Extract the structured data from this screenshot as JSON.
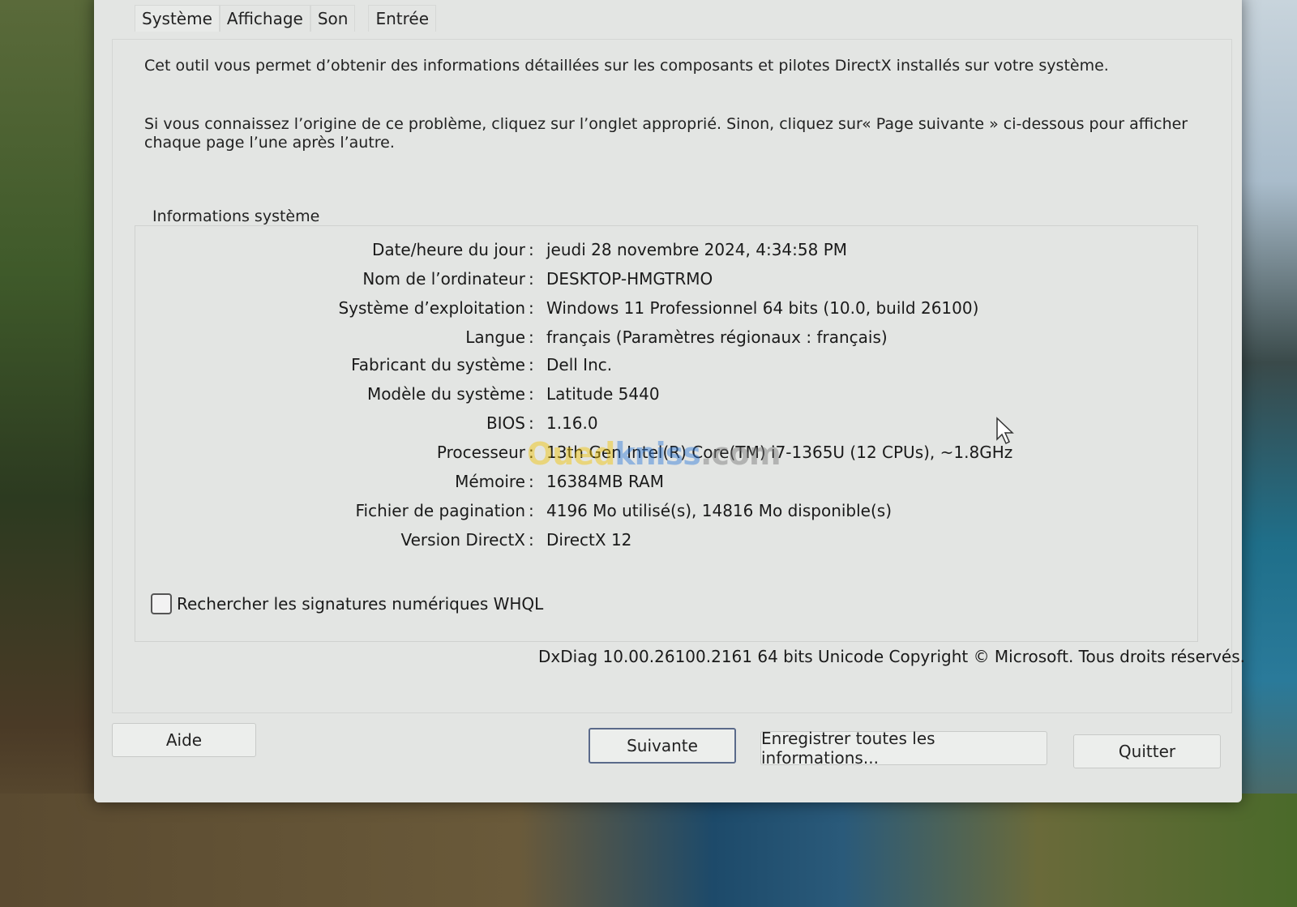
{
  "tabs": [
    "Système",
    "Affichage",
    "Son",
    "Entrée"
  ],
  "intro_1": "Cet outil vous permet d’obtenir des informations détaillées sur les composants et pilotes DirectX installés sur votre système.",
  "intro_2": "Si vous connaissez l’origine de ce problème, cliquez sur l’onglet approprié. Sinon, cliquez sur« Page suivante » ci-dessous pour afficher chaque page l’une après l’autre.",
  "group_title": "Informations système",
  "separator": ":",
  "rows": [
    {
      "label": "Date/heure du jour",
      "value": "jeudi 28 novembre 2024, 4:34:58 PM"
    },
    {
      "label": "Nom de l’ordinateur",
      "value": "DESKTOP-HMGTRMO"
    },
    {
      "label": "Système d’exploitation",
      "value": "Windows 11 Professionnel 64 bits (10.0, build 26100)"
    },
    {
      "label": "Langue",
      "value": "français (Paramètres régionaux : français)"
    },
    {
      "label": "Fabricant du système",
      "value": "Dell Inc."
    },
    {
      "label": "Modèle du système",
      "value": "Latitude 5440"
    },
    {
      "label": "BIOS",
      "value": "1.16.0"
    },
    {
      "label": "Processeur",
      "value": "13th Gen Intel(R) Core(TM) i7-1365U (12 CPUs), ~1.8GHz"
    },
    {
      "label": "Mémoire",
      "value": "16384MB RAM"
    },
    {
      "label": "Fichier de pagination",
      "value": "4196 Mo utilisé(s), 14816 Mo disponible(s)"
    },
    {
      "label": "Version DirectX",
      "value": "DirectX 12"
    }
  ],
  "whql_checkbox": {
    "label": "Rechercher les signatures numériques WHQL",
    "checked": false
  },
  "copyright": "DxDiag 10.00.26100.2161 64 bits Unicode Copyright © Microsoft. Tous droits réservés.",
  "buttons": {
    "help": "Aide",
    "next": "Suivante",
    "save_all": "Enregistrer toutes les informations...",
    "quit": "Quitter"
  },
  "watermark": {
    "part1": "Oued",
    "part2": "kniss",
    "part3": ".com",
    "colors": [
      "#f2c200",
      "#2f7bd8",
      "#777777"
    ]
  }
}
